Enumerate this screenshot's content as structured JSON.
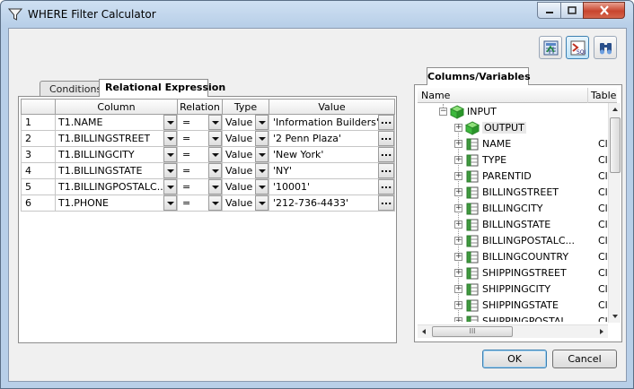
{
  "window": {
    "title": "WHERE Filter Calculator"
  },
  "toolbar": {
    "buttons": [
      {
        "name": "expression-builder-icon"
      },
      {
        "name": "sql-icon"
      },
      {
        "name": "binoculars-icon"
      }
    ]
  },
  "tabs": {
    "conditions": "Conditions",
    "relational": "Relational Expression"
  },
  "grid": {
    "headers": {
      "num": "",
      "column": "Column",
      "relation": "Relation",
      "type": "Type",
      "value": "Value"
    },
    "rows": [
      {
        "n": "1",
        "column": "T1.NAME",
        "relation": "=",
        "type": "Value",
        "value": "'Information Builders'"
      },
      {
        "n": "2",
        "column": "T1.BILLINGSTREET",
        "relation": "=",
        "type": "Value",
        "value": "'2 Penn Plaza'"
      },
      {
        "n": "3",
        "column": "T1.BILLINGCITY",
        "relation": "=",
        "type": "Value",
        "value": "'New York'"
      },
      {
        "n": "4",
        "column": "T1.BILLINGSTATE",
        "relation": "=",
        "type": "Value",
        "value": "'NY'"
      },
      {
        "n": "5",
        "column": "T1.BILLINGPOSTALC...",
        "relation": "=",
        "type": "Value",
        "value": "'10001'"
      },
      {
        "n": "6",
        "column": "T1.PHONE",
        "relation": "=",
        "type": "Value",
        "value": "'212-736-4433'"
      }
    ],
    "ellipsis": "..."
  },
  "columns_panel": {
    "tab": "Columns/Variables",
    "headers": {
      "name": "Name",
      "table": "Table"
    },
    "tree": {
      "input": "INPUT",
      "output": "OUTPUT",
      "fields": [
        {
          "name": "NAME",
          "table": "Cl"
        },
        {
          "name": "TYPE",
          "table": "Cl"
        },
        {
          "name": "PARENTID",
          "table": "Cl"
        },
        {
          "name": "BILLINGSTREET",
          "table": "Cl"
        },
        {
          "name": "BILLINGCITY",
          "table": "Cl"
        },
        {
          "name": "BILLINGSTATE",
          "table": "Cl"
        },
        {
          "name": "BILLINGPOSTALC...",
          "table": "Cl"
        },
        {
          "name": "BILLINGCOUNTRY",
          "table": "Cl"
        },
        {
          "name": "SHIPPINGSTREET",
          "table": "Cl"
        },
        {
          "name": "SHIPPINGCITY",
          "table": "Cl"
        },
        {
          "name": "SHIPPINGSTATE",
          "table": "Cl"
        },
        {
          "name": "SHIPPINGPOSTAL",
          "table": "Cl"
        }
      ]
    },
    "hscroll_grip": "III"
  },
  "buttons": {
    "ok": "OK",
    "cancel": "Cancel"
  }
}
